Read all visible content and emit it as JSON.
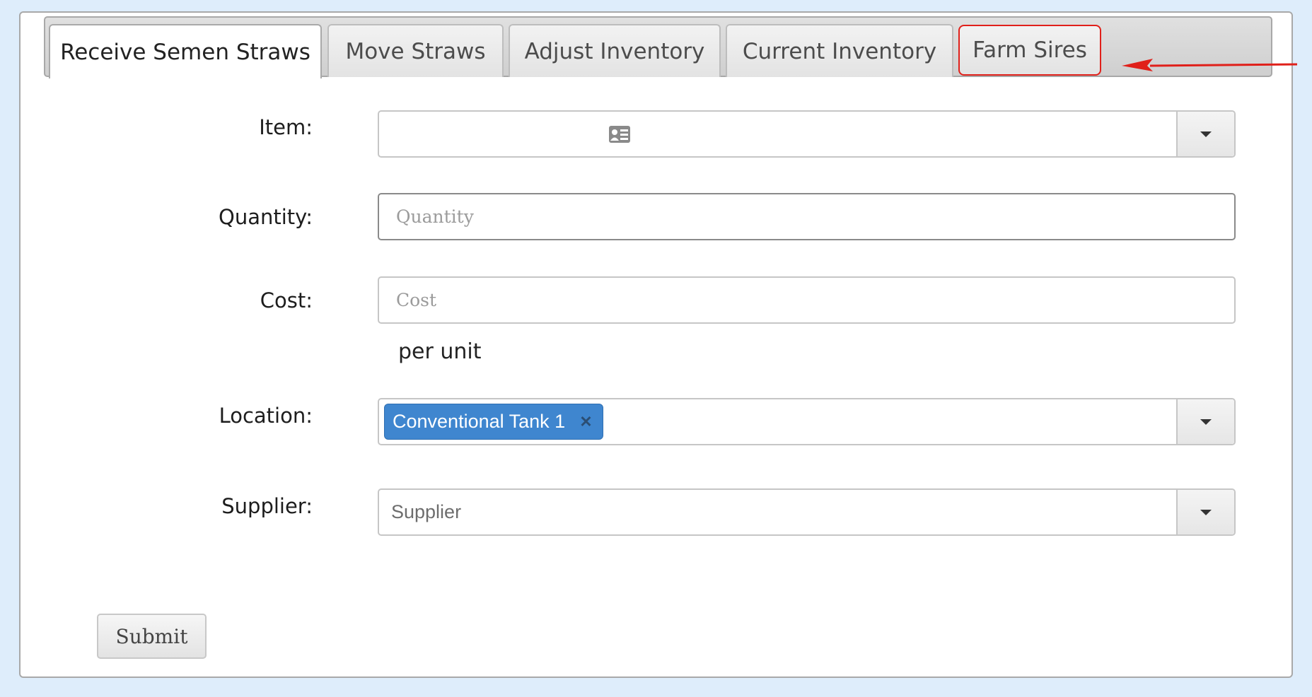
{
  "tabs": [
    {
      "label": "Receive Semen Straws",
      "active": true
    },
    {
      "label": "Move Straws"
    },
    {
      "label": "Adjust Inventory"
    },
    {
      "label": "Current Inventory"
    },
    {
      "label": "Farm Sires",
      "highlighted": true
    }
  ],
  "form": {
    "item_label": "Item:",
    "item_icon": "contact-card-icon",
    "quantity_label": "Quantity:",
    "quantity_placeholder": "Quantity",
    "cost_label": "Cost:",
    "cost_placeholder": "Cost",
    "cost_suffix": "per unit",
    "location_label": "Location:",
    "location_tag": "Conventional Tank 1",
    "supplier_label": "Supplier:",
    "supplier_placeholder": "Supplier",
    "submit_label": "Submit"
  },
  "colors": {
    "page_bg": "#deedfb",
    "tag_bg": "#3f86cf",
    "highlight": "#e0201a"
  }
}
